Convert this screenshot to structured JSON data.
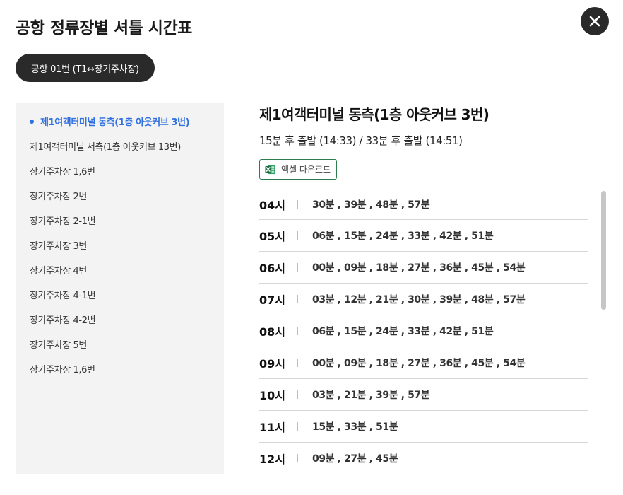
{
  "page": {
    "title": "공항 정류장별 셔틀 시간표"
  },
  "route": {
    "label": "공항 01번 (T1↔장기주차장)"
  },
  "stops": [
    {
      "label": "제1여객터미널 동측(1층 아웃커브 3번)",
      "active": true
    },
    {
      "label": "제1여객터미널 서측(1층 아웃커브 13번)",
      "active": false
    },
    {
      "label": "장기주차장 1,6번",
      "active": false
    },
    {
      "label": "장기주차장 2번",
      "active": false
    },
    {
      "label": "장기주차장 2-1번",
      "active": false
    },
    {
      "label": "장기주차장 3번",
      "active": false
    },
    {
      "label": "장기주차장 4번",
      "active": false
    },
    {
      "label": "장기주차장 4-1번",
      "active": false
    },
    {
      "label": "장기주차장 4-2번",
      "active": false
    },
    {
      "label": "장기주차장 5번",
      "active": false
    },
    {
      "label": "장기주차장 1,6번",
      "active": false
    }
  ],
  "detail": {
    "stop_title": "제1여객터미널 동측(1층 아웃커브 3번)",
    "departure": "15분 후 출발 (14:33) / 33분 후 출발 (14:51)",
    "excel_label": "엑셀 다운로드"
  },
  "schedule": [
    {
      "hour": "04시",
      "minutes": "30분 , 39분 , 48분 , 57분"
    },
    {
      "hour": "05시",
      "minutes": "06분 , 15분 , 24분 , 33분 , 42분 , 51분"
    },
    {
      "hour": "06시",
      "minutes": "00분 , 09분 , 18분 , 27분 , 36분 , 45분 , 54분"
    },
    {
      "hour": "07시",
      "minutes": "03분 , 12분 , 21분 , 30분 , 39분 , 48분 , 57분"
    },
    {
      "hour": "08시",
      "minutes": "06분 , 15분 , 24분 , 33분 , 42분 , 51분"
    },
    {
      "hour": "09시",
      "minutes": "00분 , 09분 , 18분 , 27분 , 36분 , 45분 , 54분"
    },
    {
      "hour": "10시",
      "minutes": "03분 , 21분 , 39분 , 57분"
    },
    {
      "hour": "11시",
      "minutes": "15분 , 33분 , 51분"
    },
    {
      "hour": "12시",
      "minutes": "09분 , 27분 , 45분"
    }
  ],
  "colors": {
    "accent": "#2f6fe0",
    "dark": "#2a2a2a",
    "excel_green": "#1e7145"
  },
  "icons": {
    "close": "close-icon",
    "excel": "excel-icon"
  }
}
